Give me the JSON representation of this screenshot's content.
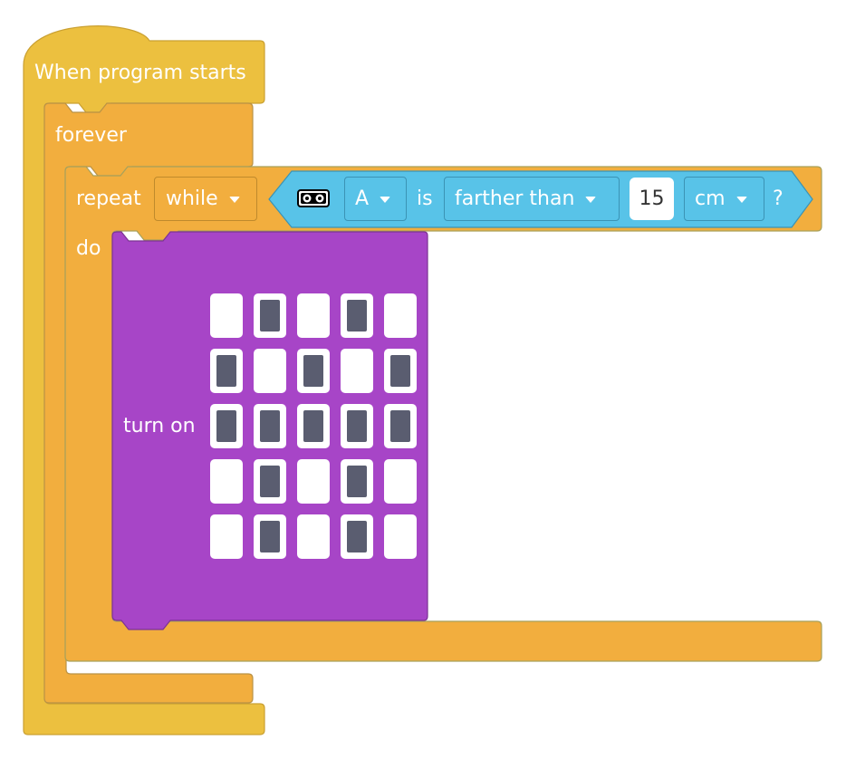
{
  "colors": {
    "events": "#ecc03f",
    "loops": "#f2ae3e",
    "sensing": "#58c3e8",
    "display": "#a745c7",
    "led_off": "#ffffff",
    "led_on": "#5a5d70"
  },
  "hat_block": {
    "label": "When program starts"
  },
  "forever_block": {
    "label": "forever"
  },
  "repeat_block": {
    "label": "repeat",
    "mode": "while",
    "do_label": "do"
  },
  "condition": {
    "sensor_icon": "distance-sensor-icon",
    "port": "A",
    "is_label": "is",
    "comparison": "farther than",
    "value": "15",
    "unit": "cm",
    "question": "?"
  },
  "display_block": {
    "label": "turn on",
    "matrix": [
      [
        0,
        1,
        0,
        1,
        0
      ],
      [
        1,
        0,
        1,
        0,
        1
      ],
      [
        1,
        1,
        1,
        1,
        1
      ],
      [
        0,
        1,
        0,
        1,
        0
      ],
      [
        0,
        1,
        0,
        1,
        0
      ]
    ]
  }
}
